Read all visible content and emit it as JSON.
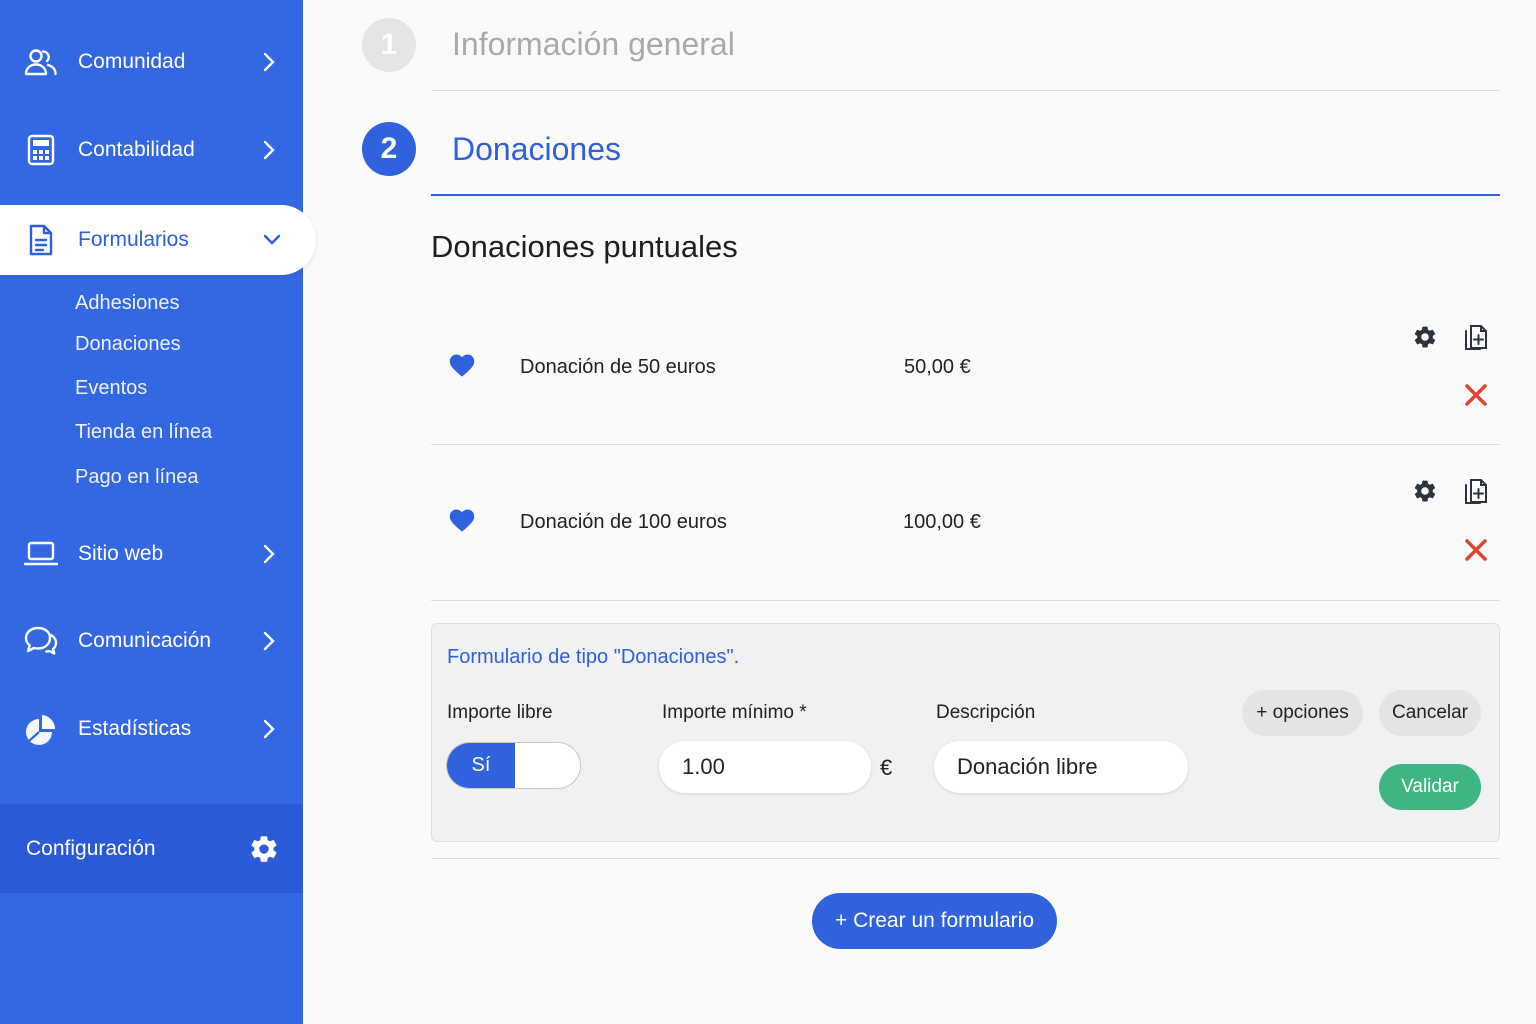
{
  "sidebar": {
    "items": [
      {
        "label": "Comunidad",
        "icon": "community-icon"
      },
      {
        "label": "Contabilidad",
        "icon": "calculator-icon"
      },
      {
        "label": "Formularios",
        "icon": "document-icon"
      },
      {
        "label": "Sitio web",
        "icon": "laptop-icon"
      },
      {
        "label": "Comunicación",
        "icon": "chat-icon"
      },
      {
        "label": "Estadísticas",
        "icon": "pie-chart-icon"
      }
    ],
    "subitems": [
      "Adhesiones",
      "Donaciones",
      "Eventos",
      "Tienda en línea",
      "Pago en línea"
    ],
    "config_label": "Configuración"
  },
  "steps": [
    {
      "number": "1",
      "title": "Información general"
    },
    {
      "number": "2",
      "title": "Donaciones"
    }
  ],
  "section_title": "Donaciones puntuales",
  "donations": [
    {
      "name": "Donación de 50 euros",
      "amount": "50,00 €"
    },
    {
      "name": "Donación de 100 euros",
      "amount": "100,00 €"
    }
  ],
  "form": {
    "title": "Formulario de tipo \"Donaciones\".",
    "free_amount_label": "Importe libre",
    "toggle_on": "Sí",
    "min_amount_label": "Importe mínimo *",
    "min_amount_value": "1.00",
    "currency": "€",
    "description_label": "Descripción",
    "description_value": "Donación libre",
    "options_button": "+ opciones",
    "cancel_button": "Cancelar",
    "validate_button": "Validar"
  },
  "create_button": "+ Crear un formulario",
  "colors": {
    "primary": "#3468e3",
    "accent": "#2f62dc",
    "success": "#3fb581",
    "danger": "#d9452f"
  }
}
